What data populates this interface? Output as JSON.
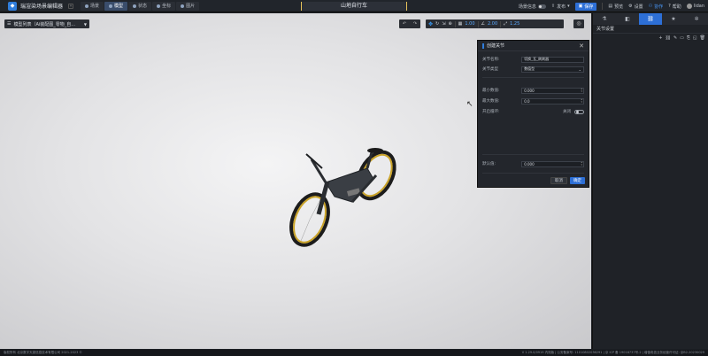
{
  "app": {
    "title": "瑞渲染场景编辑器",
    "collapse_glyph": "«",
    "nav_tabs": [
      {
        "label": "场景",
        "active": false
      },
      {
        "label": "模型",
        "active": true
      },
      {
        "label": "状态",
        "active": false
      },
      {
        "label": "坐标",
        "active": false
      },
      {
        "label": "图片",
        "active": false
      }
    ],
    "scene_title": "山地自行车"
  },
  "topright": {
    "scene_info_label": "场景信息",
    "publish_label": "发布",
    "save_label": "保存",
    "preview_label": "预览",
    "settings_label": "设置",
    "share_label": "协作",
    "help_label": "帮助",
    "user_name": "lidan"
  },
  "viewport": {
    "model_list_label": "模型列表（Ai装配图_零物_自...",
    "transform": {
      "move": "✥",
      "rotate": "↻",
      "scale": "⇲",
      "mode": "⊕",
      "v1": "1.00",
      "v2": "2.00",
      "v3": "1.25"
    },
    "undo": "↶",
    "redo": "↷",
    "focus_icon": "◎"
  },
  "dialog": {
    "title": "创建关节",
    "close": "✕",
    "fields": {
      "name_label": "关节名称:",
      "name_value": "切换_瓦_刷刷器",
      "type_label": "关节类型",
      "type_value": "数值型",
      "min_label": "最小数值:",
      "min_value": "0.000",
      "max_label": "最大数值:",
      "max_value": "0.0",
      "loop_label": "开启循环:",
      "loop_state": "关闭",
      "default_label": "默认值:",
      "default_value": "0.000"
    },
    "cancel_label": "取消",
    "ok_label": "确定"
  },
  "rpanel": {
    "tabs": [
      "⚗",
      "◧",
      "⛓",
      "★",
      "✲"
    ],
    "active_tab": 2,
    "title": "关节设置",
    "tools": [
      "+",
      "⛓",
      "✎",
      "▭",
      "⎘",
      "◱",
      "🗑"
    ]
  },
  "status": {
    "left": "版权所有 北京数字天梁信息技术有限公司 2021-2023 ©",
    "right": "V 1.29.0/0919 内测版 | 公安备案号: 11010802036291 | 京 ICP 备 19018737号-2 | 增值电信业务经营许可证: 京B2-20230029"
  },
  "colors": {
    "accent": "#2d6fd6",
    "title_border": "#e8c35a",
    "panel_bg": "#23262c"
  }
}
